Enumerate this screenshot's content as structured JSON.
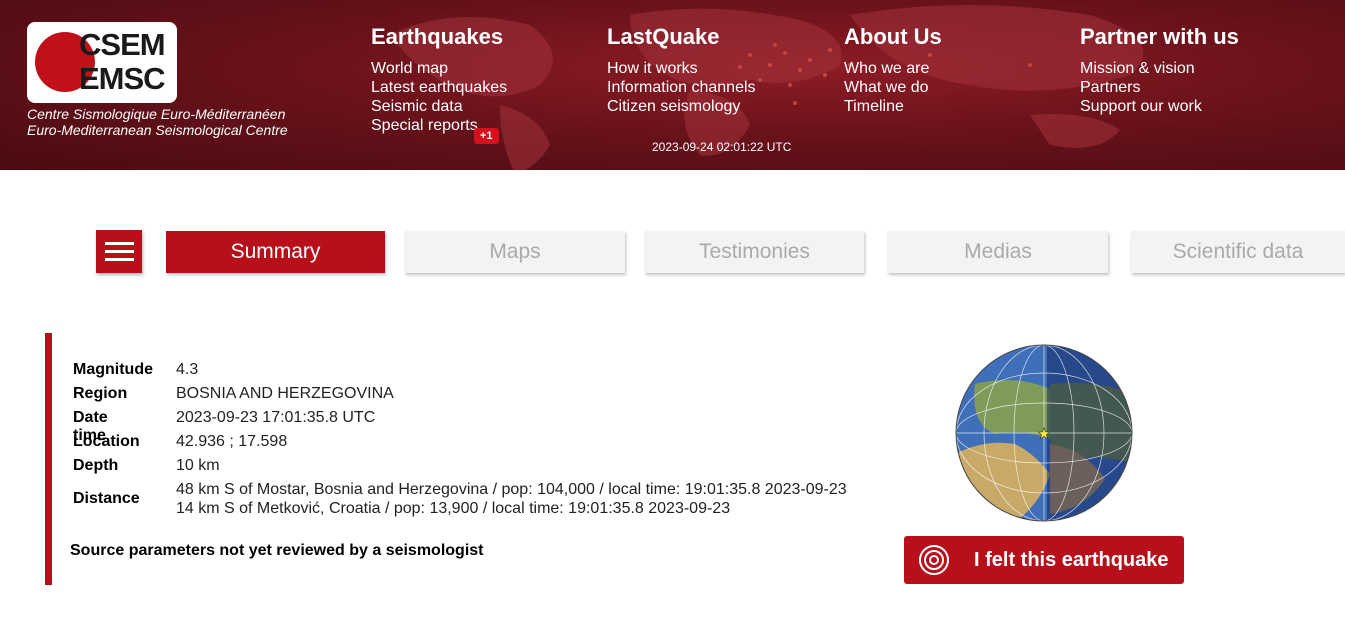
{
  "header": {
    "logo_line1": "CSEM",
    "logo_line2": "EMSC",
    "subtitle_fr": "Centre Sismologique Euro-Méditerranéen",
    "subtitle_en": "Euro-Mediterranean Seismological Centre",
    "nav": [
      {
        "title": "Earthquakes",
        "items": [
          "World map",
          "Latest earthquakes",
          "Seismic data",
          "Special reports"
        ]
      },
      {
        "title": "LastQuake",
        "items": [
          "How it works",
          "Information channels",
          "Citizen seismology"
        ]
      },
      {
        "title": "About Us",
        "items": [
          "Who we are",
          "What we do",
          "Timeline"
        ]
      },
      {
        "title": "Partner with us",
        "items": [
          "Mission & vision",
          "Partners",
          "Support our work"
        ]
      }
    ],
    "badge": "+1",
    "clock": "2023-09-24 02:01:22 UTC"
  },
  "tabs": [
    {
      "label": "Summary",
      "active": true
    },
    {
      "label": "Maps",
      "active": false
    },
    {
      "label": "Testimonies",
      "active": false
    },
    {
      "label": "Medias",
      "active": false
    },
    {
      "label": "Scientific data",
      "active": false
    }
  ],
  "event": {
    "magnitude_label": "Magnitude",
    "magnitude": "4.3",
    "region_label": "Region",
    "region": "BOSNIA AND HERZEGOVINA",
    "datetime_label": "Date time",
    "datetime": "2023-09-23 17:01:35.8 UTC",
    "location_label": "Location",
    "location": "42.936 ; 17.598",
    "depth_label": "Depth",
    "depth": "10 km",
    "distance_label": "Distance",
    "distance_1": "48 km S of Mostar, Bosnia and Herzegovina / pop: 104,000 / local time: 19:01:35.8 2023-09-23",
    "distance_2": "14 km S of Metković, Croatia / pop: 13,900 / local time: 19:01:35.8 2023-09-23",
    "note": "Source parameters not yet reviewed by a seismologist"
  },
  "felt_button": "I felt this earthquake",
  "colors": {
    "brand_red": "#b8101b",
    "header_dark": "#6a121b"
  }
}
